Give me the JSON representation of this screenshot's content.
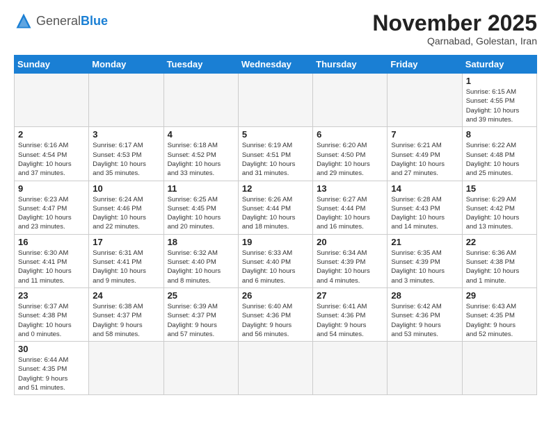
{
  "header": {
    "logo_general": "General",
    "logo_blue": "Blue",
    "month_title": "November 2025",
    "subtitle": "Qarnabad, Golestan, Iran"
  },
  "weekdays": [
    "Sunday",
    "Monday",
    "Tuesday",
    "Wednesday",
    "Thursday",
    "Friday",
    "Saturday"
  ],
  "weeks": [
    [
      {
        "day": "",
        "info": ""
      },
      {
        "day": "",
        "info": ""
      },
      {
        "day": "",
        "info": ""
      },
      {
        "day": "",
        "info": ""
      },
      {
        "day": "",
        "info": ""
      },
      {
        "day": "",
        "info": ""
      },
      {
        "day": "1",
        "info": "Sunrise: 6:15 AM\nSunset: 4:55 PM\nDaylight: 10 hours\nand 39 minutes."
      }
    ],
    [
      {
        "day": "2",
        "info": "Sunrise: 6:16 AM\nSunset: 4:54 PM\nDaylight: 10 hours\nand 37 minutes."
      },
      {
        "day": "3",
        "info": "Sunrise: 6:17 AM\nSunset: 4:53 PM\nDaylight: 10 hours\nand 35 minutes."
      },
      {
        "day": "4",
        "info": "Sunrise: 6:18 AM\nSunset: 4:52 PM\nDaylight: 10 hours\nand 33 minutes."
      },
      {
        "day": "5",
        "info": "Sunrise: 6:19 AM\nSunset: 4:51 PM\nDaylight: 10 hours\nand 31 minutes."
      },
      {
        "day": "6",
        "info": "Sunrise: 6:20 AM\nSunset: 4:50 PM\nDaylight: 10 hours\nand 29 minutes."
      },
      {
        "day": "7",
        "info": "Sunrise: 6:21 AM\nSunset: 4:49 PM\nDaylight: 10 hours\nand 27 minutes."
      },
      {
        "day": "8",
        "info": "Sunrise: 6:22 AM\nSunset: 4:48 PM\nDaylight: 10 hours\nand 25 minutes."
      }
    ],
    [
      {
        "day": "9",
        "info": "Sunrise: 6:23 AM\nSunset: 4:47 PM\nDaylight: 10 hours\nand 23 minutes."
      },
      {
        "day": "10",
        "info": "Sunrise: 6:24 AM\nSunset: 4:46 PM\nDaylight: 10 hours\nand 22 minutes."
      },
      {
        "day": "11",
        "info": "Sunrise: 6:25 AM\nSunset: 4:45 PM\nDaylight: 10 hours\nand 20 minutes."
      },
      {
        "day": "12",
        "info": "Sunrise: 6:26 AM\nSunset: 4:44 PM\nDaylight: 10 hours\nand 18 minutes."
      },
      {
        "day": "13",
        "info": "Sunrise: 6:27 AM\nSunset: 4:44 PM\nDaylight: 10 hours\nand 16 minutes."
      },
      {
        "day": "14",
        "info": "Sunrise: 6:28 AM\nSunset: 4:43 PM\nDaylight: 10 hours\nand 14 minutes."
      },
      {
        "day": "15",
        "info": "Sunrise: 6:29 AM\nSunset: 4:42 PM\nDaylight: 10 hours\nand 13 minutes."
      }
    ],
    [
      {
        "day": "16",
        "info": "Sunrise: 6:30 AM\nSunset: 4:41 PM\nDaylight: 10 hours\nand 11 minutes."
      },
      {
        "day": "17",
        "info": "Sunrise: 6:31 AM\nSunset: 4:41 PM\nDaylight: 10 hours\nand 9 minutes."
      },
      {
        "day": "18",
        "info": "Sunrise: 6:32 AM\nSunset: 4:40 PM\nDaylight: 10 hours\nand 8 minutes."
      },
      {
        "day": "19",
        "info": "Sunrise: 6:33 AM\nSunset: 4:40 PM\nDaylight: 10 hours\nand 6 minutes."
      },
      {
        "day": "20",
        "info": "Sunrise: 6:34 AM\nSunset: 4:39 PM\nDaylight: 10 hours\nand 4 minutes."
      },
      {
        "day": "21",
        "info": "Sunrise: 6:35 AM\nSunset: 4:39 PM\nDaylight: 10 hours\nand 3 minutes."
      },
      {
        "day": "22",
        "info": "Sunrise: 6:36 AM\nSunset: 4:38 PM\nDaylight: 10 hours\nand 1 minute."
      }
    ],
    [
      {
        "day": "23",
        "info": "Sunrise: 6:37 AM\nSunset: 4:38 PM\nDaylight: 10 hours\nand 0 minutes."
      },
      {
        "day": "24",
        "info": "Sunrise: 6:38 AM\nSunset: 4:37 PM\nDaylight: 9 hours\nand 58 minutes."
      },
      {
        "day": "25",
        "info": "Sunrise: 6:39 AM\nSunset: 4:37 PM\nDaylight: 9 hours\nand 57 minutes."
      },
      {
        "day": "26",
        "info": "Sunrise: 6:40 AM\nSunset: 4:36 PM\nDaylight: 9 hours\nand 56 minutes."
      },
      {
        "day": "27",
        "info": "Sunrise: 6:41 AM\nSunset: 4:36 PM\nDaylight: 9 hours\nand 54 minutes."
      },
      {
        "day": "28",
        "info": "Sunrise: 6:42 AM\nSunset: 4:36 PM\nDaylight: 9 hours\nand 53 minutes."
      },
      {
        "day": "29",
        "info": "Sunrise: 6:43 AM\nSunset: 4:35 PM\nDaylight: 9 hours\nand 52 minutes."
      }
    ],
    [
      {
        "day": "30",
        "info": "Sunrise: 6:44 AM\nSunset: 4:35 PM\nDaylight: 9 hours\nand 51 minutes."
      },
      {
        "day": "",
        "info": ""
      },
      {
        "day": "",
        "info": ""
      },
      {
        "day": "",
        "info": ""
      },
      {
        "day": "",
        "info": ""
      },
      {
        "day": "",
        "info": ""
      },
      {
        "day": "",
        "info": ""
      }
    ]
  ]
}
